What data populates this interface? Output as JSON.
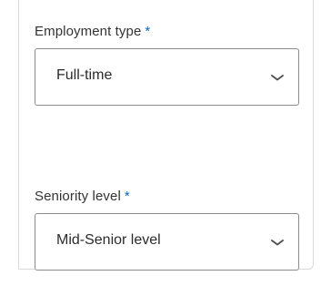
{
  "employment_type": {
    "label": "Employment type",
    "required_mark": "*",
    "selected_value": "Full-time",
    "icon": "chevron-down-icon"
  },
  "seniority_level": {
    "label": "Seniority level",
    "required_mark": "*",
    "selected_value": "Mid-Senior level",
    "icon": "chevron-down-icon"
  },
  "colors": {
    "required": "#0a66c2",
    "text": "#333333",
    "border": "#8c8c8c"
  }
}
